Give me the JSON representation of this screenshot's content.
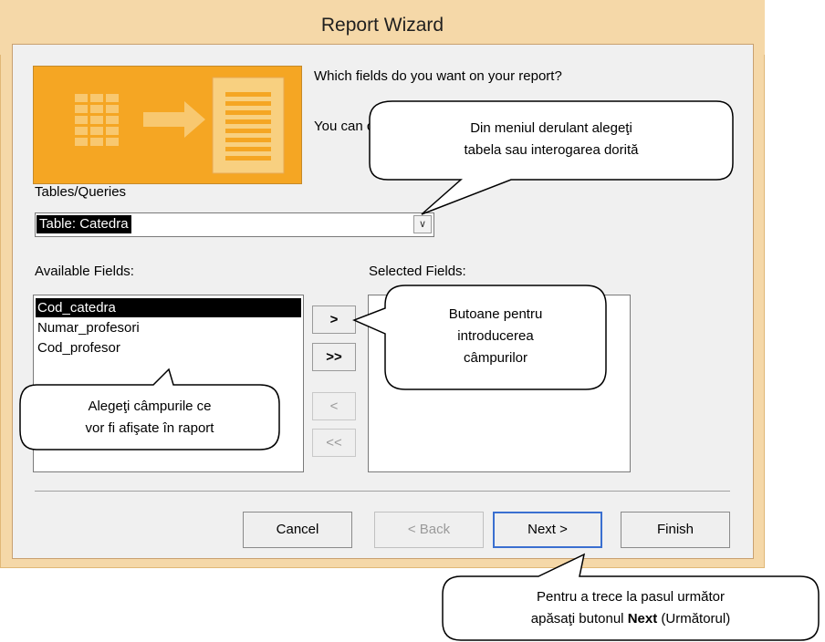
{
  "window": {
    "title": "Report Wizard"
  },
  "header": {
    "question": "Which fields do you want on your report?",
    "hint": "You can c"
  },
  "tables": {
    "label": "Tables/Queries",
    "selected": "Table: Catedra",
    "accent_color": "#f5a623"
  },
  "available": {
    "label": "Available Fields:",
    "items": [
      "Cod_catedra",
      "Numar_profesori",
      "Cod_profesor"
    ]
  },
  "selected_fields": {
    "label": "Selected Fields:"
  },
  "move_buttons": {
    "add_one": ">",
    "add_all": ">>",
    "remove_one": "<",
    "remove_all": "<<"
  },
  "footer": {
    "cancel": "Cancel",
    "back": "< Back",
    "next": "Next >",
    "finish": "Finish"
  },
  "callouts": {
    "dropdown": [
      "Din meniul derulant alegeţi",
      "tabela  sau interogarea dorită"
    ],
    "buttons": [
      "Butoane pentru",
      "introducerea",
      "câmpurilor"
    ],
    "fields": [
      "Alegeţi câmpurile ce",
      "vor fi afişate în raport"
    ],
    "next_line1": "Pentru a trece la pasul următor",
    "next_pre": "apăsaţi butonul ",
    "next_bold": "Next",
    "next_post": " (Următorul)"
  }
}
